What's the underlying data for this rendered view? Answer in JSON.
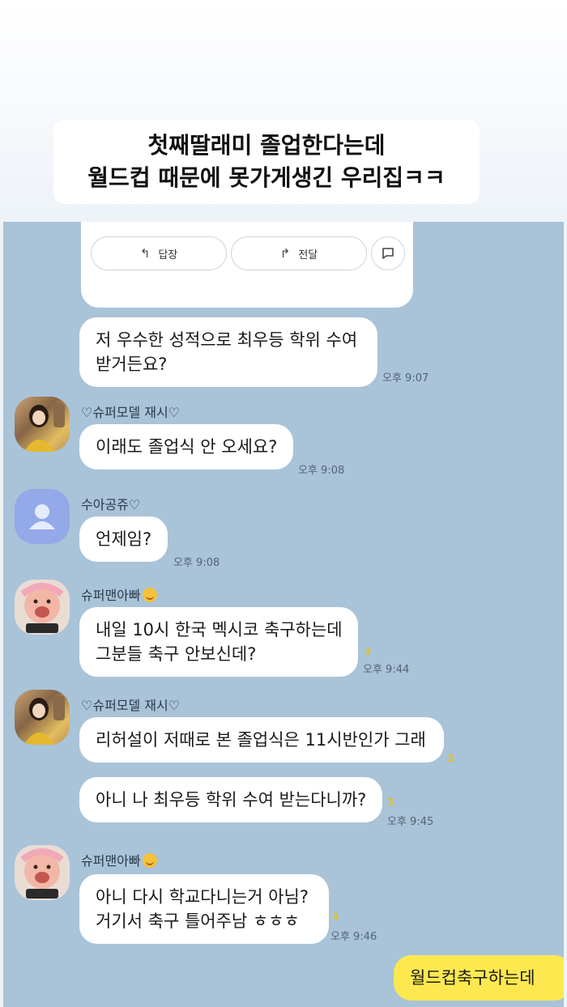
{
  "caption": {
    "line1": "첫째딸래미 졸업한다는데",
    "line2": "월드컵 때문에 못가게생긴 우리집ㅋㅋ"
  },
  "card": {
    "reply_label": "답장",
    "forward_label": "전달"
  },
  "messages": [
    {
      "text1": "저 우수한 성적으로 최우등 학위 수여",
      "text2": "받거든요?",
      "time": "오후 9:07"
    },
    {
      "sender": "♡슈퍼모델 재시♡",
      "text1": "이래도 졸업식 안 오세요?",
      "time": "오후 9:08"
    },
    {
      "sender": "수아공쥬♡",
      "text1": "언제임?",
      "time": "오후 9:08"
    },
    {
      "sender": "슈퍼맨아빠",
      "text1": "내일 10시 한국 멕시코 축구하는데",
      "text2": "그분들 축구 안보신데?",
      "unread": "3",
      "time": "오후 9:44"
    },
    {
      "sender": "♡슈퍼모델 재시♡",
      "text1": "리허설이 저때로 본 졸업식은 11시반인가 그래",
      "unread": "3"
    },
    {
      "text1": "아니 나 최우등 학위 수여 받는다니까?",
      "unread": "3",
      "time": "오후 9:45"
    },
    {
      "sender": "슈퍼맨아빠",
      "text1": "아니 다시 학교다니는거 아님?",
      "text2": "거기서 축구 틀어주남 ㅎㅎㅎ",
      "unread": "3",
      "time": "오후 9:46"
    },
    {
      "text1": "월드컵축구하는데"
    }
  ],
  "colors": {
    "chat_bg": "#a9c3d9",
    "my_bubble": "#fde94f",
    "unread": "#e0c028"
  },
  "icons": [
    "reply-arrow-icon",
    "forward-arrow-icon",
    "speech-bubble-icon",
    "default-profile-icon",
    "smiling-face-emoji-icon"
  ]
}
